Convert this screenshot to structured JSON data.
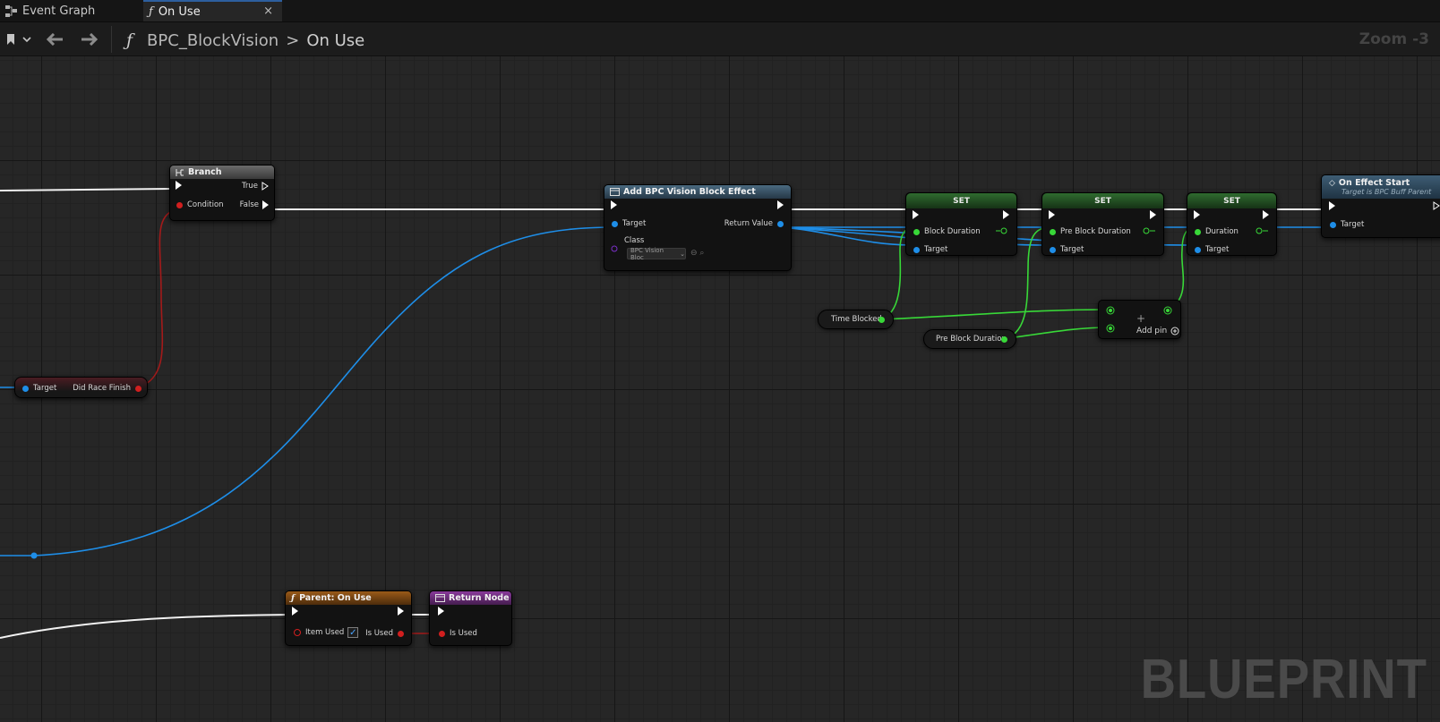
{
  "tabs": [
    {
      "label": "Event Graph",
      "active": false
    },
    {
      "label": "On Use",
      "active": true
    }
  ],
  "tab_close_glyph": "×",
  "toolbar": {
    "breadcrumb_blueprint": "BPC_BlockVision",
    "breadcrumb_sep": ">",
    "breadcrumb_function": "On Use",
    "zoom": "Zoom -3"
  },
  "watermark": "BLUEPRINT",
  "colors": {
    "exec": "#ffffff",
    "object_pin": "#1e8ee8",
    "float_pin": "#38d838",
    "bool_pin": "#d11f1f",
    "function_header": "#3a5566",
    "set_header": "#2f6b2f",
    "parent_header": "#8a4f14",
    "return_header": "#7a2b8c"
  },
  "nodes": {
    "branch": {
      "title": "Branch",
      "true_label": "True",
      "false_label": "False",
      "condition_label": "Condition"
    },
    "getter": {
      "target_label": "Target",
      "output_label": "Did Race Finish"
    },
    "add_effect": {
      "title": "Add BPC Vision Block Effect",
      "target_label": "Target",
      "return_label": "Return Value",
      "class_label": "Class",
      "class_value": "BPC Vision Bloc"
    },
    "set1": {
      "title": "SET",
      "var_label": "Block Duration",
      "target_label": "Target"
    },
    "set2": {
      "title": "SET",
      "var_label": "Pre Block Duration",
      "target_label": "Target"
    },
    "set3": {
      "title": "SET",
      "var_label": "Duration",
      "target_label": "Target"
    },
    "effect_start": {
      "title": "On Effect Start",
      "subtitle": "Target is BPC Buff Parent",
      "target_label": "Target"
    },
    "time_blocked": {
      "label": "Time Blocked"
    },
    "pre_block_duration": {
      "label": "Pre Block Duration"
    },
    "add_node": {
      "add_pin_label": "Add pin",
      "plus": "+"
    },
    "parent_on_use": {
      "title": "Parent: On Use",
      "item_used_label": "Item Used",
      "is_used_label": "Is Used",
      "item_used_checked": true
    },
    "return_node": {
      "title": "Return Node",
      "is_used_label": "Is Used"
    }
  }
}
